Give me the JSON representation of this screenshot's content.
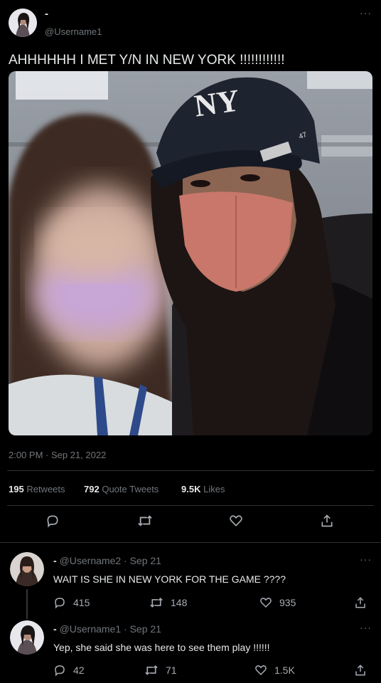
{
  "tweet": {
    "display_name": "-",
    "handle": "@Username1",
    "text": "AHHHHHH I MET Y/N IN NEW YORK !!!!!!!!!!!!",
    "photo_cap_text": "NY",
    "timestamp": "2:00 PM · Sep 21, 2022",
    "stats": {
      "retweets_count": "195",
      "retweets_label": "Retweets",
      "quotes_count": "792",
      "quotes_label": "Quote Tweets",
      "likes_count": "9.5K",
      "likes_label": "Likes"
    }
  },
  "replies": [
    {
      "display_name": "-",
      "handle_date": "@Username2 · Sep 21",
      "text": "WAIT IS SHE IN NEW YORK FOR THE GAME ????",
      "replies": "415",
      "retweets": "148",
      "likes": "935"
    },
    {
      "display_name": "-",
      "handle_date": "@Username1 · Sep 21",
      "text": "Yep, she said she was here to see them play !!!!!!",
      "replies": "42",
      "retweets": "71",
      "likes": "1.5K"
    }
  ],
  "icons": [
    "more-icon",
    "reply-icon",
    "retweet-icon",
    "like-icon",
    "share-icon"
  ]
}
